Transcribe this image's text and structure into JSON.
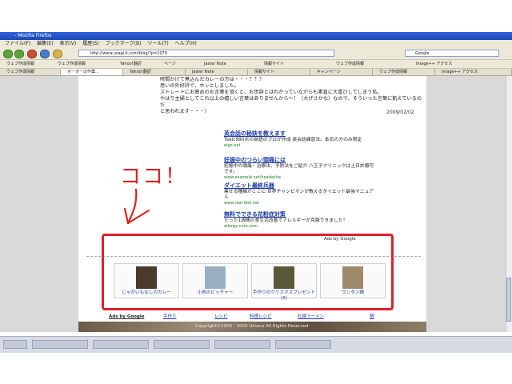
{
  "browser": {
    "title": "- Mozilla Firefox",
    "menu": [
      "ファイル(F)",
      "編集(E)",
      "表示(V)",
      "履歴(S)",
      "ブックマーク(B)",
      "ツール(T)",
      "ヘルプ(H)"
    ],
    "url": "http://www.usagi-k.com/blog/?p=1079",
    "search_placeholder": "Google",
    "bookmarks": [
      "ウェブ作成情報",
      "ウェブ作成情報",
      "Yahoo!翻訳",
      "ページ",
      "Jaster Note",
      "情報サイト",
      "ウェブ作成情報",
      "image++ アクセス"
    ],
    "tabs": [
      "ウェブ作成情報",
      "ボーダーの作業...",
      "Yahoo!翻訳",
      "Jaster Note",
      "情報サイト",
      "キャンペーン",
      "ウェブ作成情報",
      "image++ アクセス"
    ]
  },
  "post": {
    "lines": [
      "時間かけて煮込んだカレーの方は・・・？？？",
      "思いの外好評で、ホッとしました。",
      "ストレートにお褒めのお言葉を頂くと、お世辞とはわかっていながらも素直に大喜びしてしまう私。",
      "やはり主婦としてこれ以上の嬉しい言葉はありませんから～！（大げさかな）なので、そういった言葉に飢えているのだ",
      "と思われます・・・）"
    ],
    "date": "2009/02/02"
  },
  "ads": [
    {
      "title": "英会話の秘訣を教えます",
      "desc": "Toeic990点の英語のプロが作成 英会話練習法。本気の方のみ限定",
      "url": "eigo.net"
    },
    {
      "title": "妊娠中のつらい頭痛には",
      "desc": "妊娠中の頭痛・治療法、予防法をご紹介 八王子クリニックは土日診療可です。",
      "url": "www.example.net/headache"
    },
    {
      "title": "ダイエット最終兵器",
      "desc": "痩せる種類がここに 世界チャンピオンが教えるダイエット最強マニュアル",
      "url": "www.real-diet.net"
    },
    {
      "title": "無料でできる花粉症対策",
      "desc": "たった1週間の食生活改善でアレルギーが克服できました！",
      "url": "allergy-cure.com"
    }
  ],
  "ads_by_google": "Ads by Google",
  "related": [
    {
      "label": "じゃがいもなしのカレー"
    },
    {
      "label": "小鳥のピッチャー"
    },
    {
      "label": "手作りのクリスマスプレゼント(5)"
    },
    {
      "label": "ワンタン鍋"
    }
  ],
  "link_unit": {
    "ads_label": "Ads by Google",
    "links": [
      "手作り",
      "レシピ",
      "料理レシピ",
      "札幌ラーメン",
      "鍋"
    ]
  },
  "footer": "Copyright©2006 - 2009 Umeco All Rights Reserved.",
  "annotation": {
    "text": "ココ！",
    "color": "#e02020"
  },
  "taskbar": [
    "",
    "",
    "",
    "",
    "",
    ""
  ]
}
